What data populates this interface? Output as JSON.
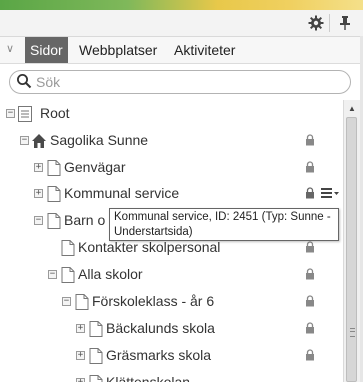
{
  "toolbar": {
    "settings_icon": "gear-icon",
    "pin_icon": "pin-icon"
  },
  "tabs": [
    {
      "label": "Sidor",
      "active": true
    },
    {
      "label": "Webbplatser",
      "active": false
    },
    {
      "label": "Aktiviteter",
      "active": false
    }
  ],
  "search": {
    "placeholder": "Sök",
    "value": ""
  },
  "tree": {
    "rows": [
      {
        "label": "Root",
        "expander": "−"
      },
      {
        "label": "Sagolika Sunne",
        "expander": "−"
      },
      {
        "label": "Genvägar",
        "expander": "+"
      },
      {
        "label": "Kommunal service",
        "expander": "+"
      },
      {
        "label": "Barn o",
        "expander": "−"
      },
      {
        "label": "Kontakter skolpersonal",
        "expander": ""
      },
      {
        "label": "Alla skolor",
        "expander": "−"
      },
      {
        "label": "Förskoleklass - år 6",
        "expander": "−"
      },
      {
        "label": "Bäckalunds skola",
        "expander": "+"
      },
      {
        "label": "Gräsmarks skola",
        "expander": "+"
      },
      {
        "label": "Klättenskolan",
        "expander": "+"
      }
    ]
  },
  "tooltip": {
    "line1": "Kommunal service, ID: 2451 (Typ: Sunne -",
    "line2": "Understartsida)"
  },
  "colors": {
    "active_tab_bg": "#666666",
    "home_icon": "#4a4a4a"
  }
}
